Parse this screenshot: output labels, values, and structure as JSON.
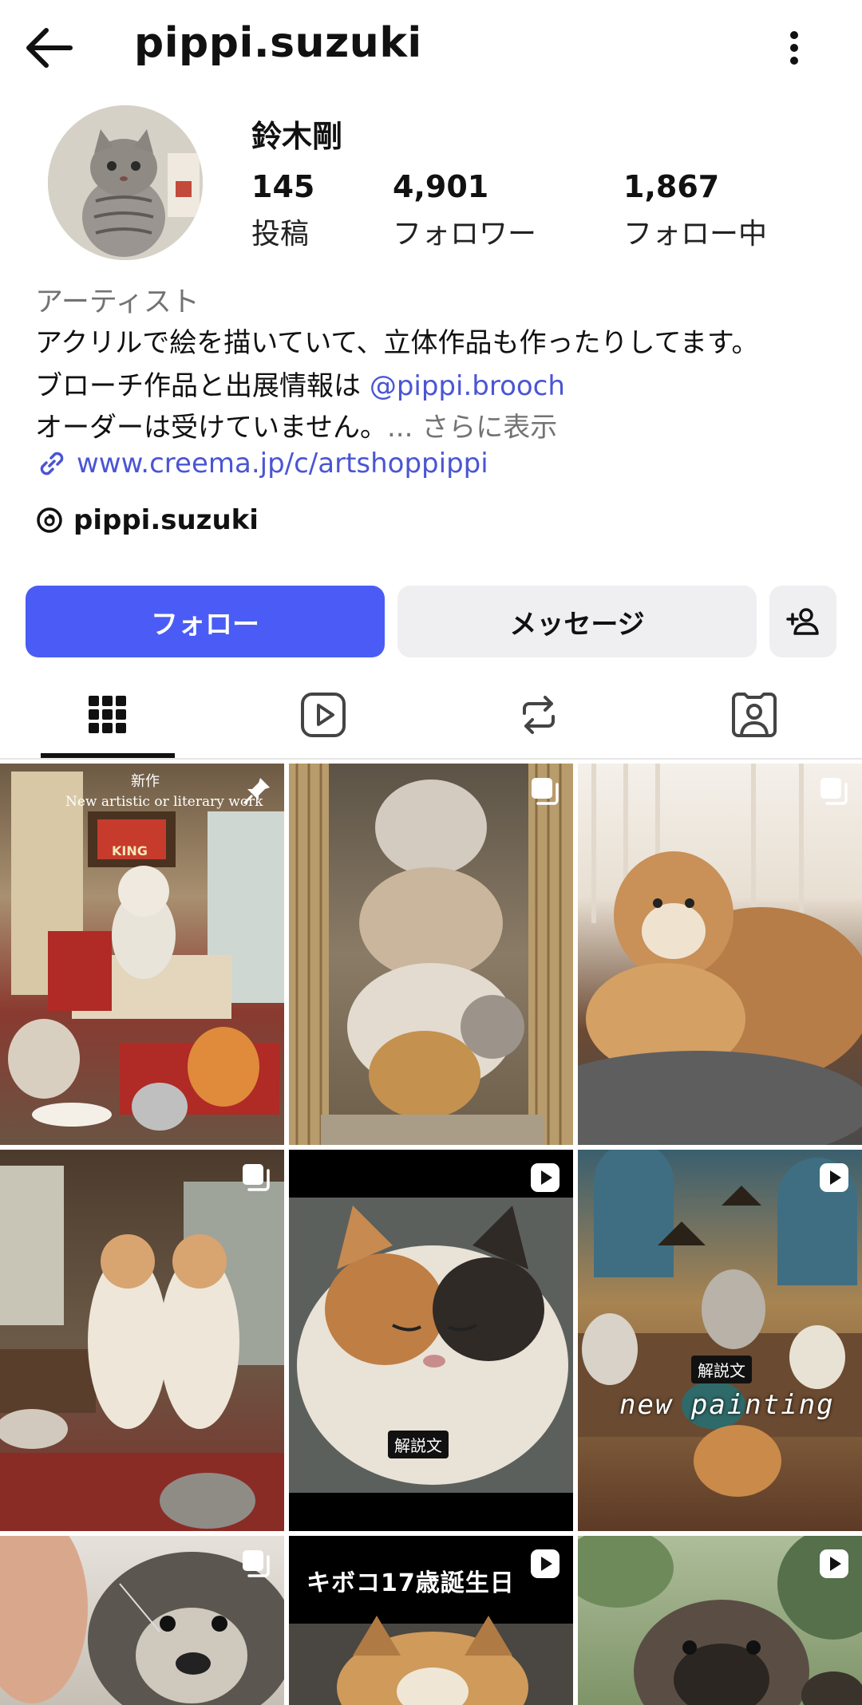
{
  "header": {
    "username": "pippi.suzuki",
    "back_icon": "arrow-left-icon",
    "menu_icon": "more-vertical-icon"
  },
  "profile": {
    "display_name": "鈴木剛",
    "stats": [
      {
        "value": "145",
        "label": "投稿"
      },
      {
        "value": "4,901",
        "label": "フォロワー"
      },
      {
        "value": "1,867",
        "label": "フォロー中"
      }
    ],
    "category": "アーティスト",
    "bio_line1": "アクリルで絵を描いていて、立体作品も作ったりしてます。",
    "bio_line2_prefix": "ブローチ作品と出展情報は ",
    "bio_mention": "@pippi.brooch",
    "bio_line3": "オーダーは受けていません。",
    "bio_more": "... さらに表示",
    "link": "www.creema.jp/c/artshoppippi",
    "threads_handle": "pippi.suzuki"
  },
  "actions": {
    "follow": "フォロー",
    "message": "メッセージ"
  },
  "tabs": [
    "grid-icon",
    "reels-icon",
    "reposts-icon",
    "tagged-icon"
  ],
  "colors": {
    "accent": "#4a5cf5",
    "link": "#4a55d4",
    "secondary_text": "#737373",
    "button_bg": "#efeff2"
  },
  "posts": [
    {
      "badge": "pin-icon",
      "caption1": "新作",
      "caption2": "New artistic or literary work",
      "sign": "KING"
    },
    {
      "badge": "carousel-icon"
    },
    {
      "badge": "carousel-icon"
    },
    {
      "badge": "carousel-icon"
    },
    {
      "badge": "reel-icon",
      "label": "解説文"
    },
    {
      "badge": "reel-icon",
      "label": "解説文",
      "overlay": "new painting"
    },
    {
      "badge": "carousel-icon"
    },
    {
      "badge": "reel-icon",
      "overlay": "キボコ17歳誕生日"
    },
    {
      "badge": "reel-icon"
    }
  ]
}
